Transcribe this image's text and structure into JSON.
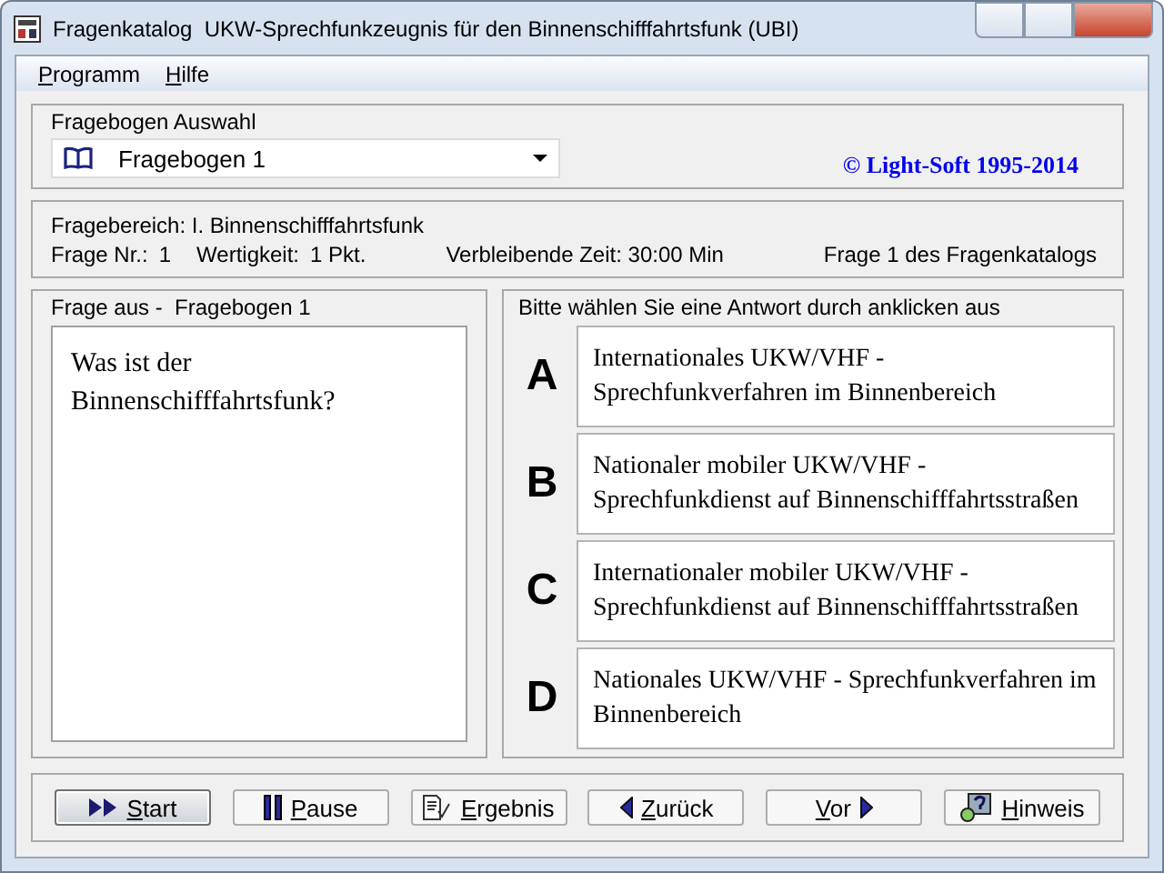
{
  "window": {
    "title": "Fragenkatalog  UKW-Sprechfunkzeugnis für den Binnenschifffahrtsfunk (UBI)"
  },
  "menu": [
    {
      "label": "Programm"
    },
    {
      "label": "Hilfe"
    }
  ],
  "selection": {
    "title": "Fragebogen Auswahl",
    "value": "Fragebogen 1",
    "copyright": "© Light-Soft 1995-2014"
  },
  "info": {
    "area": "Fragebereich: I. Binnenschifffahrtsfunk",
    "number_label": "Frage Nr.:",
    "number": "1",
    "weight_label": "Wertigkeit:",
    "weight": "1 Pkt.",
    "time": "Verbleibende Zeit: 30:00 Min",
    "position": "Frage 1 des Fragenkatalogs"
  },
  "question": {
    "title": "Frage aus -  Fragebogen 1",
    "text": "Was ist der Binnenschifffahrtsfunk?"
  },
  "answers": {
    "prompt": "Bitte wählen Sie eine Antwort durch anklicken aus",
    "options": [
      {
        "letter": "A",
        "text": "Internationales UKW/VHF - Sprechfunkverfahren im Binnenbereich"
      },
      {
        "letter": "B",
        "text": "Nationaler mobiler UKW/VHF - Sprechfunkdienst auf Binnenschifffahrtsstraßen"
      },
      {
        "letter": "C",
        "text": "Internationaler mobiler UKW/VHF - Sprechfunkdienst auf Binnenschifffahrtsstraßen"
      },
      {
        "letter": "D",
        "text": "Nationales UKW/VHF - Sprechfunkverfahren im Binnenbereich"
      }
    ]
  },
  "buttons": [
    {
      "label": "Start",
      "kind": "play",
      "focused": true
    },
    {
      "label": "Pause",
      "kind": "pause",
      "focused": false
    },
    {
      "label": "Ergebnis",
      "kind": "result",
      "focused": false
    },
    {
      "label": "Zurück",
      "kind": "back",
      "focused": false
    },
    {
      "label": "Vor",
      "kind": "forward",
      "focused": false
    },
    {
      "label": "Hinweis",
      "kind": "hint",
      "focused": false
    }
  ]
}
